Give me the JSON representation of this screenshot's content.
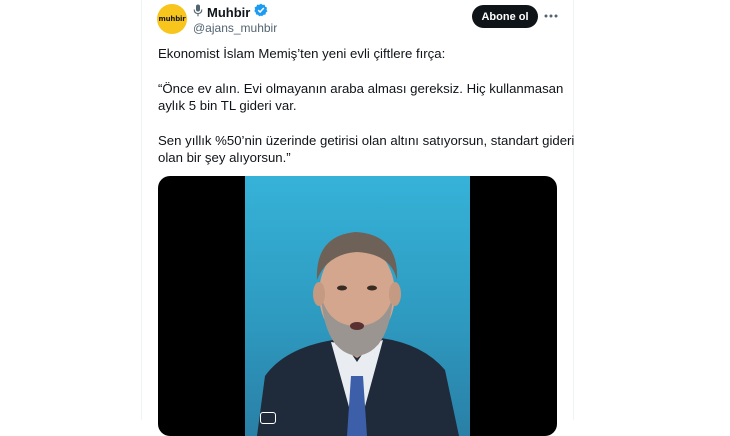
{
  "account": {
    "avatar_text": "muhbir",
    "name": "Muhbir",
    "handle": "@ajans_muhbir",
    "verified": true,
    "brand_color": "#f7c51b"
  },
  "actions": {
    "follow_label": "Abone ol",
    "more_icon": "more-horizontal-icon"
  },
  "tweet": {
    "lines": [
      "Ekonomist İslam Memiş’ten yeni evli çiftlere fırça:",
      "“Önce ev alın. Evi olmayanın araba alması gereksiz. Hiç kullanmasan",
      "aylık 5 bin TL gideri var.",
      "Sen yıllık %50’nin üzerinde getirisi olan altını satıyorsun, standart gideri",
      "olan bir şey alıyorsun.”"
    ]
  },
  "media": {
    "type": "video",
    "background_color": "#36b2d8"
  },
  "colors": {
    "text": "#0f1419",
    "secondary": "#536471",
    "verified": "#1d9bf0",
    "button": "#0f1419"
  }
}
